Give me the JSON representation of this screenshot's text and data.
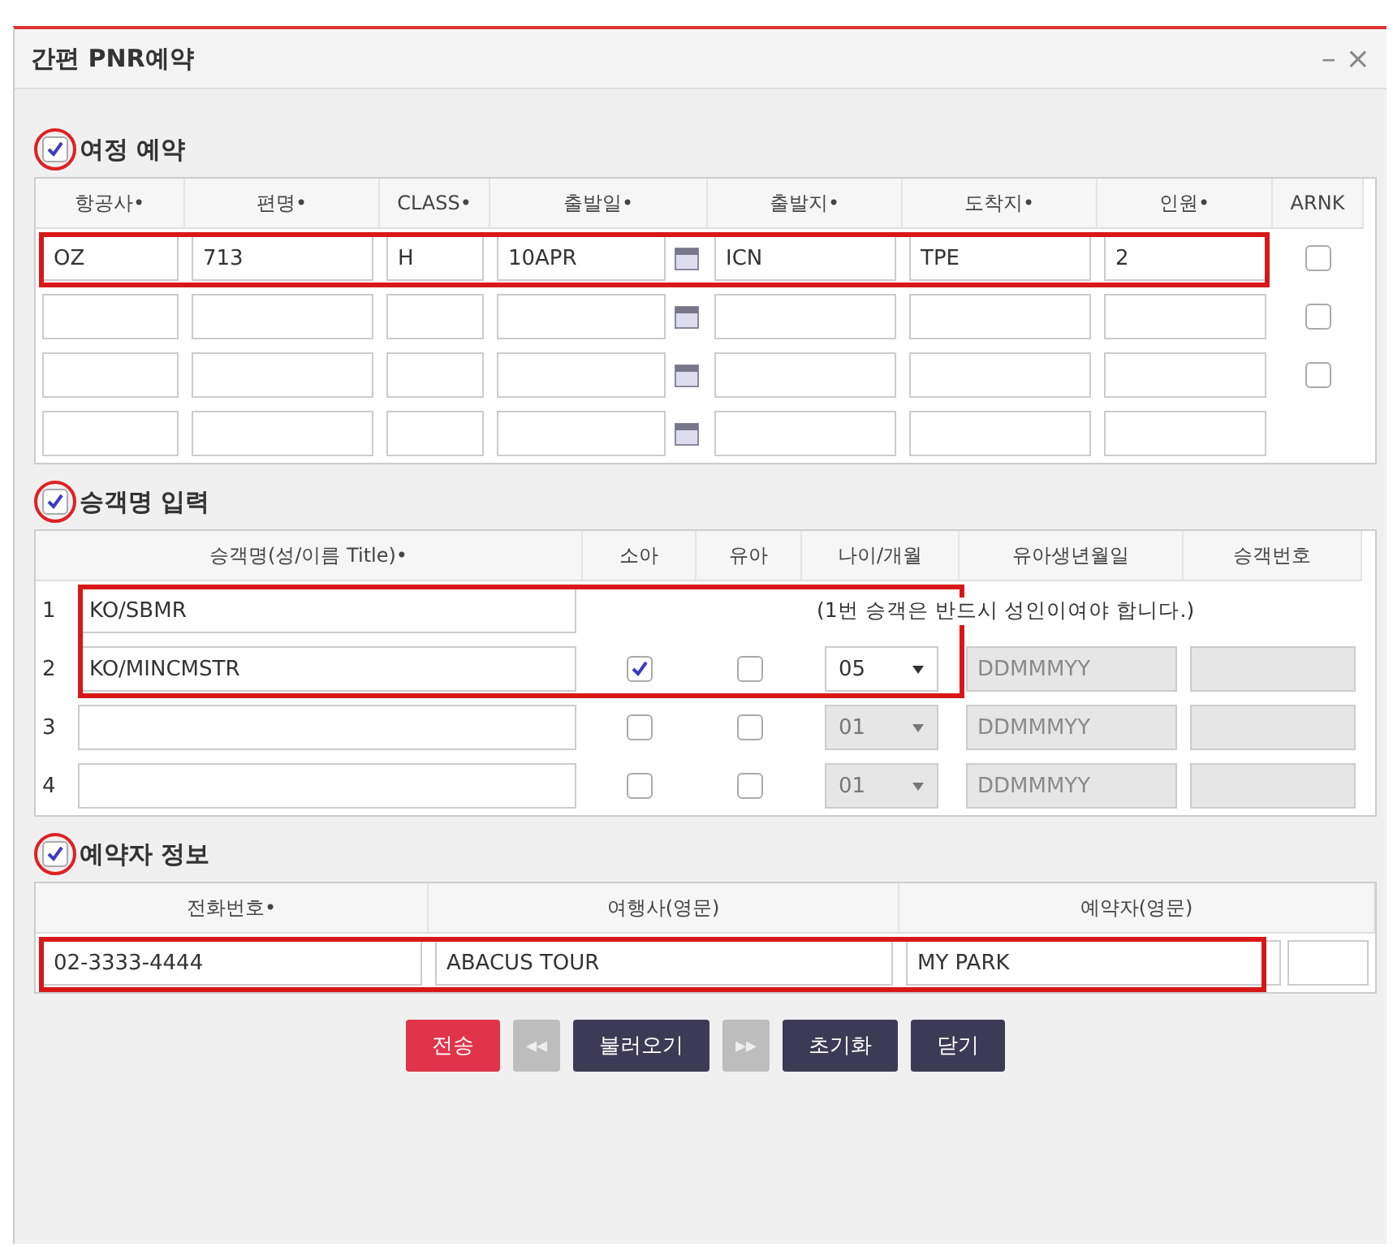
{
  "window": {
    "title": "간편 PNR예약",
    "minimize": "–",
    "close": "×"
  },
  "itinerary": {
    "checked": true,
    "circled": true,
    "heading": "여정 예약",
    "columns": [
      "항공사•",
      "편명•",
      "CLASS•",
      "출발일•",
      "출발지•",
      "도착지•",
      "인원•",
      "ARNK"
    ],
    "rows": [
      {
        "highlighted": true,
        "airline": "OZ",
        "flight": "713",
        "class": "H",
        "date": "10APR",
        "from": "ICN",
        "to": "TPE",
        "pax": "2",
        "arnk": false
      },
      {
        "highlighted": false,
        "airline": "",
        "flight": "",
        "class": "",
        "date": "",
        "from": "",
        "to": "",
        "pax": "",
        "arnk": false
      },
      {
        "highlighted": false,
        "airline": "",
        "flight": "",
        "class": "",
        "date": "",
        "from": "",
        "to": "",
        "pax": "",
        "arnk": false
      },
      {
        "highlighted": false,
        "airline": "",
        "flight": "",
        "class": "",
        "date": "",
        "from": "",
        "to": "",
        "pax": ""
      }
    ]
  },
  "passengers": {
    "checked": true,
    "circled": true,
    "heading": "승객명 입력",
    "columns": [
      "승객명(성/이름 Title)•",
      "소아",
      "유아",
      "나이/개월",
      "유아생년월일",
      "승객번호"
    ],
    "rows": [
      {
        "highlighted": true,
        "number": "1",
        "name": "KO/SBMR",
        "note": "(1번 승객은 반드시 성인이여야 합니다.)"
      },
      {
        "highlighted": true,
        "number": "2",
        "name": "KO/MINCMSTR",
        "child": true,
        "infant": false,
        "age": "05",
        "age_disabled": false,
        "birth_placeholder": "DDMMMYY"
      },
      {
        "highlighted": false,
        "number": "3",
        "name": "",
        "child": false,
        "infant": false,
        "age": "01",
        "age_disabled": true,
        "birth_placeholder": "DDMMMYY"
      },
      {
        "highlighted": false,
        "number": "4",
        "name": "",
        "child": false,
        "infant": false,
        "age": "01",
        "age_disabled": true,
        "birth_placeholder": "DDMMMYY"
      }
    ]
  },
  "booker": {
    "checked": true,
    "circled": true,
    "heading": "예약자 정보",
    "columns": [
      "전화번호•",
      "여행사(영문)",
      "예약자(영문)"
    ],
    "highlighted": true,
    "phone": "02-3333-4444",
    "agency": "ABACUS TOUR",
    "name": "MY PARK"
  },
  "buttons": [
    {
      "kind": "primary",
      "label": "전송"
    },
    {
      "kind": "nav",
      "label": "◂◂",
      "disabled": true
    },
    {
      "kind": "dark",
      "label": "불러오기"
    },
    {
      "kind": "nav",
      "label": "▸▸",
      "disabled": true
    },
    {
      "kind": "dark",
      "label": "초기화"
    },
    {
      "kind": "dark",
      "label": "닫기"
    }
  ]
}
